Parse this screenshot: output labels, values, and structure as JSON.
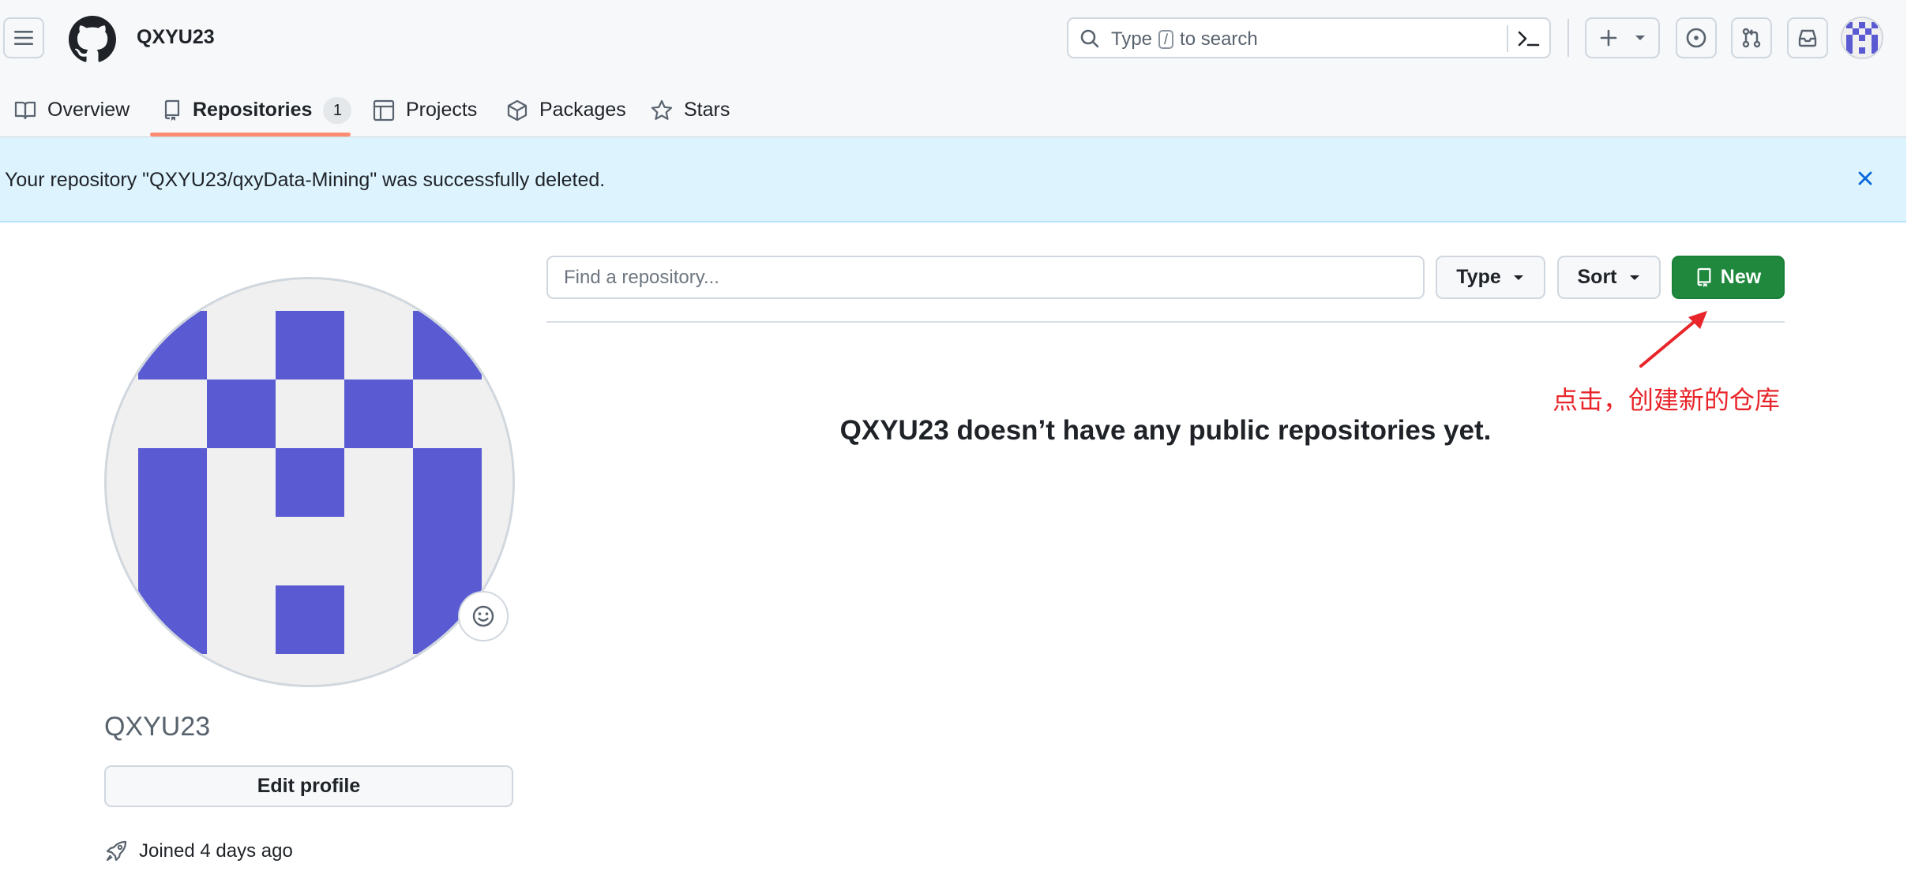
{
  "header": {
    "owner": "QXYU23",
    "search": {
      "label_prefix": "Type",
      "shortcut_key": "/",
      "label_suffix": "to search"
    }
  },
  "tabs": [
    {
      "label": "Overview",
      "icon": "book-icon"
    },
    {
      "label": "Repositories",
      "icon": "repo-icon",
      "counter": "1",
      "active": true
    },
    {
      "label": "Projects",
      "icon": "table-icon"
    },
    {
      "label": "Packages",
      "icon": "package-icon"
    },
    {
      "label": "Stars",
      "icon": "star-icon"
    }
  ],
  "flash": {
    "message": "Your repository \"QXYU23/qxyData-Mining\" was successfully deleted."
  },
  "profile": {
    "name": "QXYU23",
    "edit_label": "Edit profile",
    "joined": "Joined 4 days ago"
  },
  "repos": {
    "find_placeholder": "Find a repository...",
    "type_label": "Type",
    "sort_label": "Sort",
    "new_label": "New",
    "empty_message": "QXYU23 doesn’t have any public repositories yet."
  },
  "annotation": {
    "text": "点击，创建新的仓库",
    "color": "#e8252a"
  },
  "colors": {
    "accent": "#1f883d",
    "flash_bg": "#ddf4ff",
    "identicon": "#5a5bd3",
    "tab_underline": "#fd8c73"
  }
}
